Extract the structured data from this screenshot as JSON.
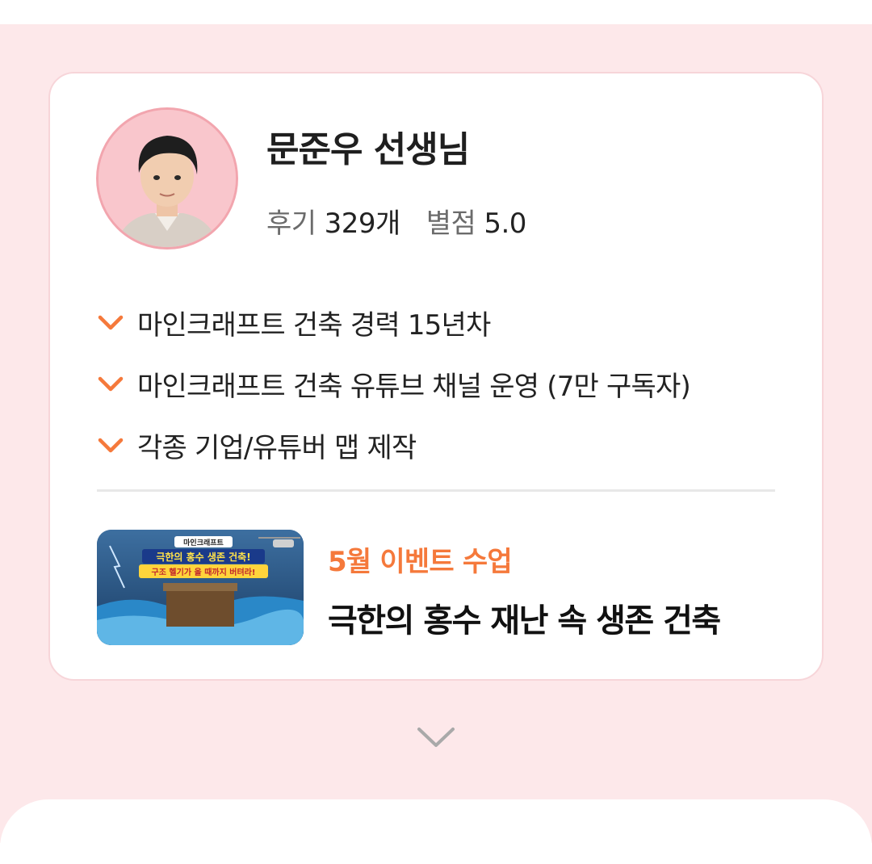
{
  "teacher": {
    "name": "문준우 선생님",
    "reviews_label": "후기",
    "reviews_value": "329개",
    "rating_label": "별점",
    "rating_value": "5.0"
  },
  "features": [
    "마인크래프트 건축 경력 15년차",
    "마인크래프트 건축 유튜브 채널 운영 (7만 구독자)",
    "각종 기업/유튜버 맵 제작"
  ],
  "event": {
    "tag": "5월 이벤트 수업",
    "title": "극한의 홍수 재난 속 생존 건축",
    "thumbnail_lines": [
      "마인크래프트",
      "극한의 홍수 생존 건축!",
      "구조 헬기가 올 때까지 버텨라!"
    ]
  },
  "icons": {
    "check": "check-icon",
    "expand": "chevron-down-icon"
  },
  "colors": {
    "accent": "#f5793b",
    "background": "#fde8ea",
    "avatar_bg": "#f9c6cc"
  }
}
